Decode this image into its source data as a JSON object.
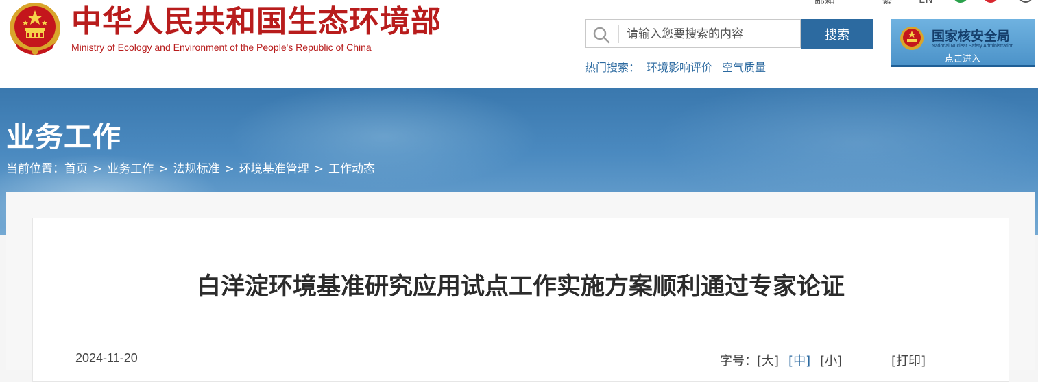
{
  "header": {
    "site_title_cn": "中华人民共和国生态环境部",
    "site_title_en": "Ministry of Ecology and Environment of the People's Republic of China",
    "top_links": [
      "邮箱",
      "繁",
      "EN"
    ]
  },
  "search": {
    "placeholder": "请输入您要搜索的内容",
    "button_label": "搜索",
    "hot_label": "热门搜索：",
    "hot_terms": [
      "环境影响评价",
      "空气质量"
    ]
  },
  "nnsa_banner": {
    "title": "国家核安全局",
    "subtitle": "National Nuclear Safety Administration",
    "enter_label": "点击进入"
  },
  "section": {
    "title": "业务工作",
    "breadcrumb_prefix": "当前位置：",
    "breadcrumb": [
      "首页",
      "业务工作",
      "法规标准",
      "环境基准管理",
      "工作动态"
    ],
    "separator": ">"
  },
  "article": {
    "title": "白洋淀环境基准研究应用试点工作实施方案顺利通过专家论证",
    "date": "2024-11-20",
    "font_size_label": "字号：",
    "font_sizes": [
      "[大]",
      "[中]",
      "[小]"
    ],
    "print_label": "[打印]"
  },
  "colors": {
    "brand_red": "#b81c1c",
    "brand_blue": "#2c6aa0"
  }
}
